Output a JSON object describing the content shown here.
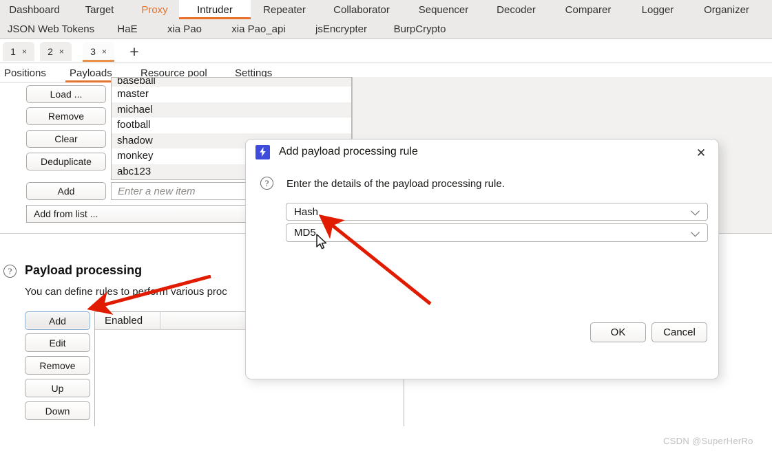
{
  "colors": {
    "accent": "#e8712a",
    "nav_bg": "#eceae8",
    "dialog_icon_bg": "#3e4bdb",
    "annotation_red": "#e01b00",
    "focus_border": "#7fa6cc"
  },
  "topnav": {
    "row1": [
      {
        "label": "Dashboard",
        "state": "normal"
      },
      {
        "label": "Target",
        "state": "normal"
      },
      {
        "label": "Proxy",
        "state": "highlight"
      },
      {
        "label": "Intruder",
        "state": "active"
      },
      {
        "label": "Repeater",
        "state": "normal"
      },
      {
        "label": "Collaborator",
        "state": "normal"
      },
      {
        "label": "Sequencer",
        "state": "normal"
      },
      {
        "label": "Decoder",
        "state": "normal"
      },
      {
        "label": "Comparer",
        "state": "normal"
      },
      {
        "label": "Logger",
        "state": "normal"
      },
      {
        "label": "Organizer",
        "state": "normal"
      }
    ],
    "row2": [
      {
        "label": "JSON Web Tokens",
        "state": "normal"
      },
      {
        "label": "HaE",
        "state": "normal"
      },
      {
        "label": "xia Pao",
        "state": "normal"
      },
      {
        "label": "xia Pao_api",
        "state": "normal"
      },
      {
        "label": "jsEncrypter",
        "state": "normal"
      },
      {
        "label": "BurpCrypto",
        "state": "normal"
      }
    ]
  },
  "attack_tabs": {
    "tabs": [
      {
        "label": "1",
        "close": "×",
        "active": false
      },
      {
        "label": "2",
        "close": "×",
        "active": false
      },
      {
        "label": "3",
        "close": "×",
        "active": true
      }
    ],
    "new_tab_label": "+"
  },
  "subtabs": [
    {
      "label": "Positions",
      "active": false
    },
    {
      "label": "Payloads",
      "active": true
    },
    {
      "label": "Resource pool",
      "active": false
    },
    {
      "label": "Settings",
      "active": false
    }
  ],
  "payload_settings": {
    "buttons": [
      {
        "label": "Load ..."
      },
      {
        "label": "Remove"
      },
      {
        "label": "Clear"
      },
      {
        "label": "Deduplicate"
      }
    ],
    "add_button": "Add",
    "add_from_list_button": "Add from list ...",
    "new_item_placeholder": "Enter a new item",
    "new_item_value": "",
    "list_items": [
      "baseball",
      "master",
      "michael",
      "football",
      "shadow",
      "monkey",
      "abc123"
    ]
  },
  "payload_processing": {
    "help_icon": "?",
    "title": "Payload processing",
    "description": "You can define rules to perform various proc",
    "buttons": [
      {
        "label": "Add",
        "focused": true
      },
      {
        "label": "Edit",
        "focused": false
      },
      {
        "label": "Remove",
        "focused": false
      },
      {
        "label": "Up",
        "focused": false
      },
      {
        "label": "Down",
        "focused": false
      }
    ],
    "table": {
      "columns": [
        "Enabled",
        ""
      ],
      "rows": []
    }
  },
  "dialog": {
    "icon": "burp-bolt-icon",
    "icon_glyph": "⚡",
    "title": "Add payload processing rule",
    "close_glyph": "✕",
    "help_icon": "?",
    "prompt": "Enter the details of the payload processing rule.",
    "rule_type": {
      "value": "Hash",
      "options": [
        "Hash"
      ]
    },
    "hash_algorithm": {
      "value": "MD5",
      "options": [
        "MD5"
      ]
    },
    "ok_label": "OK",
    "cancel_label": "Cancel"
  },
  "annotations": {
    "arrow_to_dropdown": "red-arrow",
    "arrow_to_add_button": "red-arrow"
  },
  "watermark": "CSDN @SuperHerRo"
}
